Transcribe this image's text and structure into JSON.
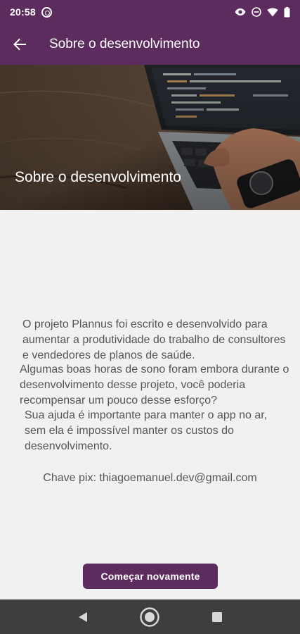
{
  "status_bar": {
    "time": "20:58",
    "icons": [
      "at-sign-icon",
      "eye-icon",
      "dnd-icon",
      "wifi-icon",
      "battery-icon"
    ]
  },
  "toolbar": {
    "back_icon": "arrow-left-icon",
    "title": "Sobre o desenvolvimento"
  },
  "hero": {
    "title": "Sobre o desenvolvimento"
  },
  "content": {
    "paragraph1": "O projeto Plannus foi escrito e desenvolvido para aumentar a produtividade do trabalho de consultores e vendedores de planos de saúde.",
    "paragraph2": "Algumas boas horas de sono foram embora durante o desenvolvimento desse projeto, você poderia recompensar um pouco desse esforço?",
    "paragraph3": "Sua ajuda é importante para manter o app no ar, sem ela é impossível manter os custos do desenvolvimento.",
    "pix_key": "Chave pix: thiagoemanuel.dev@gmail.com",
    "restart_button": "Começar novamente"
  },
  "nav_bar": {
    "icons": [
      "back-triangle-icon",
      "home-circle-icon",
      "recents-square-icon"
    ]
  },
  "colors": {
    "primary": "#5b2c5d",
    "background": "#f1f1f1",
    "text": "#555555",
    "nav_bar": "#3e3e3e"
  }
}
